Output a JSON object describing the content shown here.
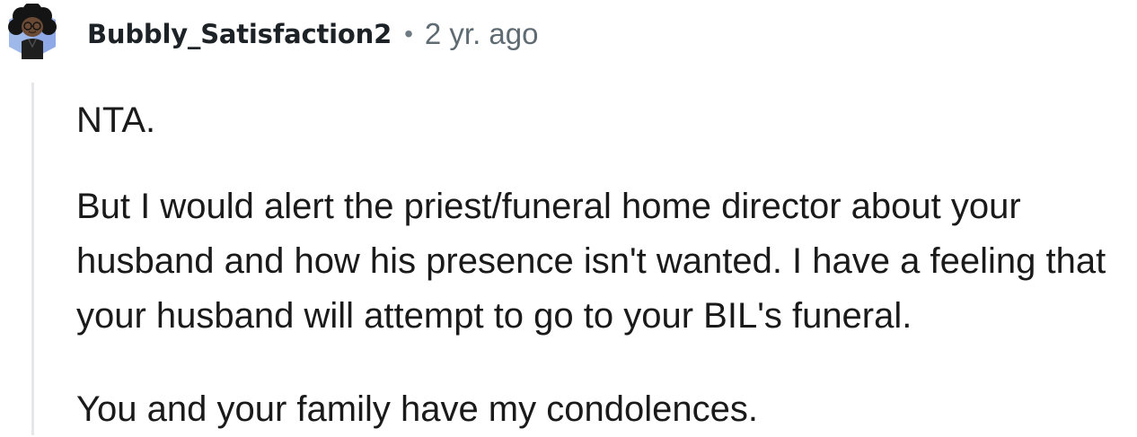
{
  "comment": {
    "author": "Bubbly_Satisfaction2",
    "separator": "•",
    "timestamp": "2 yr. ago",
    "avatar_icon": "snoo-avatar-icon",
    "paragraphs": [
      "NTA.",
      "But I would alert the priest/funeral home director about your husband and how his presence isn't wanted. I have a feeling that your husband will attempt to go to your BIL's funeral.",
      "You and your family have my condolences."
    ]
  },
  "colors": {
    "thread_line": "#e5e7e9",
    "username": "#1c2226",
    "timestamp": "#5f6b72",
    "body_text": "#1a1a1b",
    "avatar_bg": "#9fb8ea"
  }
}
